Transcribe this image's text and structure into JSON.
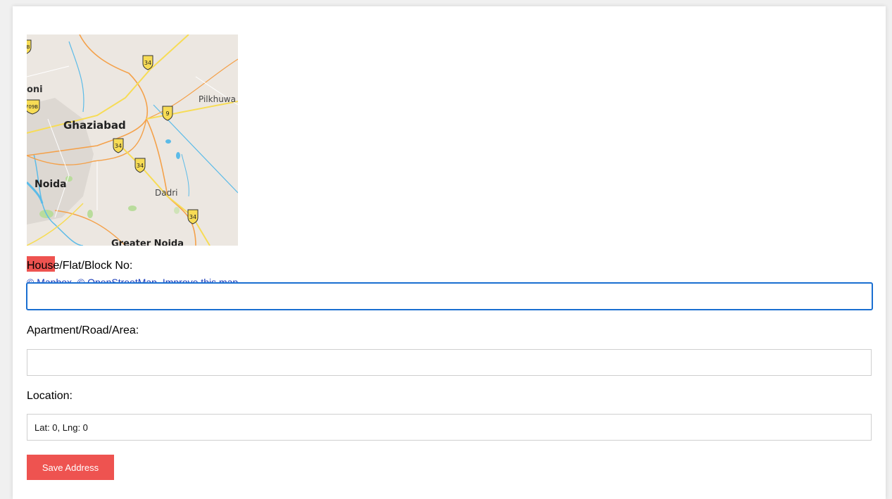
{
  "map": {
    "place_labels": [
      "Ghaziabad",
      "Noida",
      "Dadri",
      "Pilkhuwa",
      "Greater Noida",
      "oni"
    ],
    "highway_shields": [
      "34",
      "34",
      "34",
      "34",
      "9",
      "709B",
      "B"
    ],
    "attribution": [
      "© Mapbox",
      "© OpenStreetMap",
      "Improve this map"
    ]
  },
  "form": {
    "house_label": "House/Flat/Block No:",
    "house_value": "",
    "area_label": "Apartment/Road/Area:",
    "area_value": "",
    "location_label": "Location:",
    "location_value": "Lat: 0, Lng: 0",
    "save_label": "Save Address"
  },
  "colors": {
    "accent": "#ee5350",
    "focus": "#1a6fd1",
    "map_land": "#ece7e1",
    "map_road": "#f4a14a",
    "map_water": "#5bbbe8"
  }
}
